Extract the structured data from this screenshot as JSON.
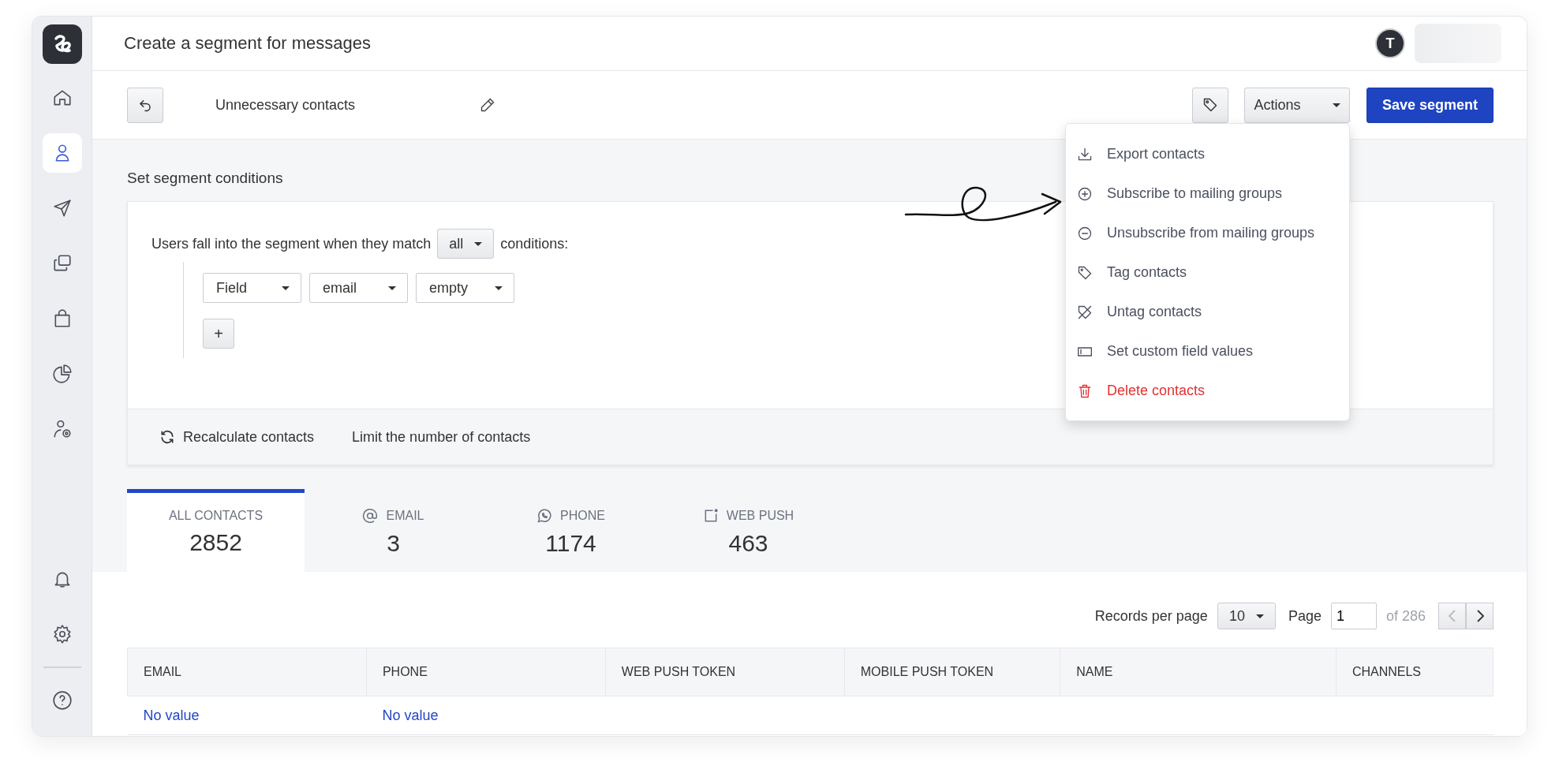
{
  "header": {
    "title": "Create a segment for messages",
    "avatar_letter": "T"
  },
  "sidebar": {
    "items": [
      {
        "selected": false
      },
      {
        "selected": true
      },
      {
        "selected": false
      },
      {
        "selected": false
      },
      {
        "selected": false
      },
      {
        "selected": false
      },
      {
        "selected": false
      }
    ]
  },
  "toolbar": {
    "segment_name": "Unnecessary contacts",
    "actions_label": "Actions",
    "save_label": "Save segment"
  },
  "actions_menu": [
    {
      "label": "Export contacts",
      "kind": "normal"
    },
    {
      "label": "Subscribe to mailing groups",
      "kind": "normal"
    },
    {
      "label": "Unsubscribe from mailing groups",
      "kind": "normal"
    },
    {
      "label": "Tag contacts",
      "kind": "normal"
    },
    {
      "label": "Untag contacts",
      "kind": "normal"
    },
    {
      "label": "Set custom field values",
      "kind": "normal"
    },
    {
      "label": "Delete contacts",
      "kind": "danger"
    }
  ],
  "conditions": {
    "title": "Set segment conditions",
    "sentence_before": "Users fall into the segment when they match",
    "match": "all",
    "sentence_after": "conditions:",
    "rule": [
      "Field",
      "email",
      "empty"
    ],
    "add_label": "+",
    "footer": {
      "recalculate": "Recalculate contacts",
      "limit": "Limit the number of contacts"
    }
  },
  "stats_tabs": [
    {
      "label": "ALL CONTACTS",
      "count": "2852",
      "selected": true
    },
    {
      "label": "EMAIL",
      "count": "3",
      "selected": false
    },
    {
      "label": "PHONE",
      "count": "1174",
      "selected": false
    },
    {
      "label": "WEB PUSH",
      "count": "463",
      "selected": false
    }
  ],
  "pagination": {
    "records_label": "Records per page",
    "per_page": "10",
    "page_label": "Page",
    "page": "1",
    "of": "of 286"
  },
  "table": {
    "columns": [
      "EMAIL",
      "PHONE",
      "WEB PUSH TOKEN",
      "MOBILE PUSH TOKEN",
      "NAME",
      "CHANNELS"
    ],
    "rows": [
      [
        "No value",
        "No value",
        "",
        "",
        "",
        ""
      ]
    ]
  }
}
